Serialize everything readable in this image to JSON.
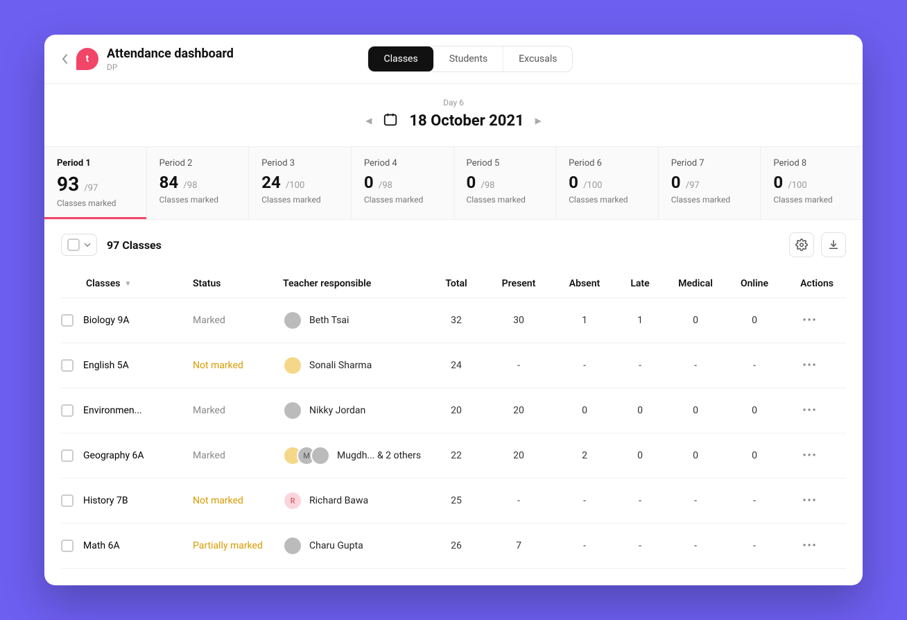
{
  "header": {
    "logo_letter": "t",
    "title": "Attendance dashboard",
    "subtitle": "DP"
  },
  "tabs": {
    "classes": "Classes",
    "students": "Students",
    "excusals": "Excusals"
  },
  "date": {
    "day_label": "Day 6",
    "text": "18 October 2021"
  },
  "periods": [
    {
      "label": "Period 1",
      "num": "93",
      "total": "/97",
      "sub": "Classes marked",
      "active": true
    },
    {
      "label": "Period 2",
      "num": "84",
      "total": "/98",
      "sub": "Classes marked",
      "active": false
    },
    {
      "label": "Period 3",
      "num": "24",
      "total": "/100",
      "sub": "Classes marked",
      "active": false
    },
    {
      "label": "Period 4",
      "num": "0",
      "total": "/98",
      "sub": "Classes marked",
      "active": false
    },
    {
      "label": "Period 5",
      "num": "0",
      "total": "/98",
      "sub": "Classes marked",
      "active": false
    },
    {
      "label": "Period 6",
      "num": "0",
      "total": "/100",
      "sub": "Classes marked",
      "active": false
    },
    {
      "label": "Period 7",
      "num": "0",
      "total": "/97",
      "sub": "Classes marked",
      "active": false
    },
    {
      "label": "Period 8",
      "num": "0",
      "total": "/100",
      "sub": "Classes marked",
      "active": false
    }
  ],
  "toolbar": {
    "count": "97 Classes"
  },
  "columns": {
    "classes": "Classes",
    "status": "Status",
    "teacher": "Teacher responsible",
    "total": "Total",
    "present": "Present",
    "absent": "Absent",
    "late": "Late",
    "medical": "Medical",
    "online": "Online",
    "actions": "Actions"
  },
  "rows": [
    {
      "class": "Biology 9A",
      "status": "Marked",
      "status_class": "status-marked",
      "teacher": "Beth Tsai",
      "avatars": [
        {
          "cls": "gray",
          "ch": ""
        }
      ],
      "total": "32",
      "present": "30",
      "absent": "1",
      "late": "1",
      "medical": "0",
      "online": "0"
    },
    {
      "class": "English 5A",
      "status": "Not marked",
      "status_class": "status-notmarked",
      "teacher": "Sonali Sharma",
      "avatars": [
        {
          "cls": "yellow",
          "ch": ""
        }
      ],
      "total": "24",
      "present": "-",
      "absent": "-",
      "late": "-",
      "medical": "-",
      "online": "-"
    },
    {
      "class": "Environmen...",
      "status": "Marked",
      "status_class": "status-marked",
      "teacher": "Nikky Jordan",
      "avatars": [
        {
          "cls": "gray",
          "ch": ""
        }
      ],
      "total": "20",
      "present": "20",
      "absent": "0",
      "late": "0",
      "medical": "0",
      "online": "0"
    },
    {
      "class": "Geography 6A",
      "status": "Marked",
      "status_class": "status-marked",
      "teacher": "Mugdh... & 2 others",
      "avatars": [
        {
          "cls": "yellow",
          "ch": ""
        },
        {
          "cls": "gray",
          "ch": "M"
        },
        {
          "cls": "gray",
          "ch": ""
        }
      ],
      "total": "22",
      "present": "20",
      "absent": "2",
      "late": "0",
      "medical": "0",
      "online": "0"
    },
    {
      "class": "History 7B",
      "status": "Not marked",
      "status_class": "status-notmarked",
      "teacher": "Richard Bawa",
      "avatars": [
        {
          "cls": "pink",
          "ch": "R"
        }
      ],
      "total": "25",
      "present": "-",
      "absent": "-",
      "late": "-",
      "medical": "-",
      "online": "-"
    },
    {
      "class": "Math 6A",
      "status": "Partially marked",
      "status_class": "status-partial",
      "teacher": "Charu Gupta",
      "avatars": [
        {
          "cls": "gray",
          "ch": ""
        }
      ],
      "total": "26",
      "present": "7",
      "absent": "-",
      "late": "-",
      "medical": "-",
      "online": "-"
    }
  ]
}
